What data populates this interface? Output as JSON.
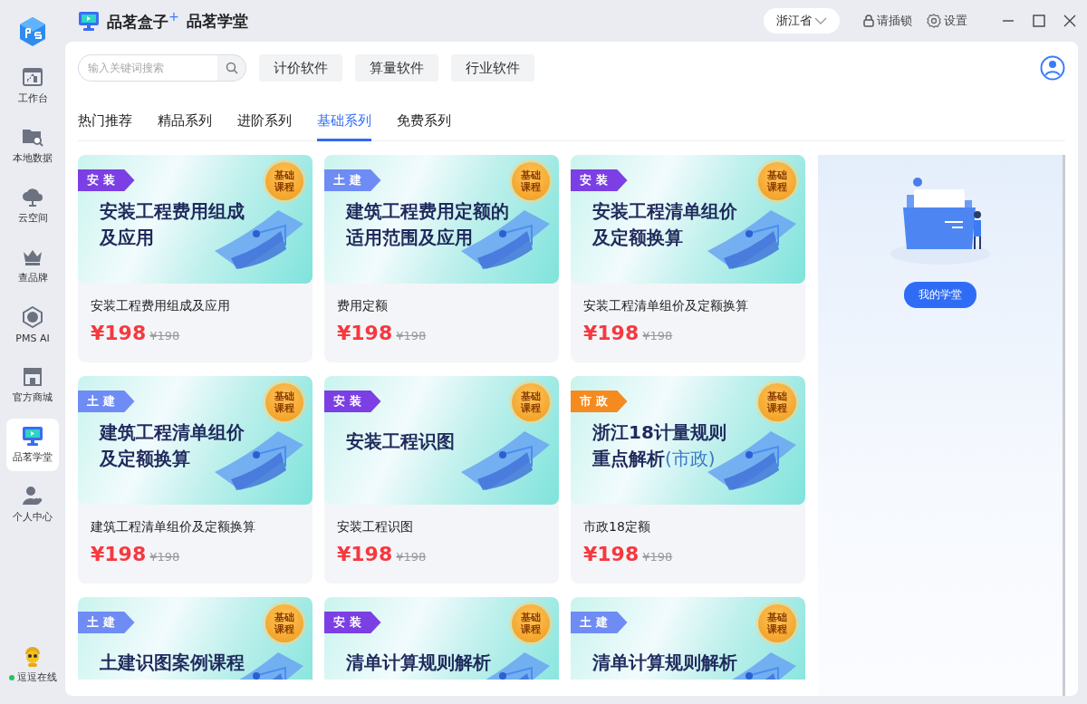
{
  "titlebar": {
    "app_name": "品茗盒子$^{+}$",
    "section": "品茗学堂",
    "region": "浙江省",
    "lock": "请插锁",
    "settings": "设置"
  },
  "sidebar": {
    "items": [
      {
        "label": "工作台",
        "selected": false
      },
      {
        "label": "本地数据",
        "selected": false
      },
      {
        "label": "云空间",
        "selected": false
      },
      {
        "label": "查品牌",
        "selected": false
      },
      {
        "label": "PMS AI",
        "selected": false
      },
      {
        "label": "官方商城",
        "selected": false
      },
      {
        "label": "品茗学堂",
        "selected": true
      },
      {
        "label": "个人中心",
        "selected": false
      }
    ],
    "status": {
      "label": "逗逗在线",
      "online": true
    }
  },
  "toolbar": {
    "search": {
      "placeholder": "输入关键词搜索"
    },
    "buttons": [
      "计价软件",
      "算量软件",
      "行业软件"
    ]
  },
  "tabs": [
    {
      "label": "热门推荐",
      "selected": false
    },
    {
      "label": "精品系列",
      "selected": false
    },
    {
      "label": "进阶系列",
      "selected": false
    },
    {
      "label": "基础系列",
      "selected": true
    },
    {
      "label": "免费系列",
      "selected": false
    }
  ],
  "courses": [
    {
      "tag": "安 装",
      "color": "#7b3fe4",
      "badge": "基础课程",
      "banner_lines": [
        "安装工程费用组成",
        "及应用"
      ],
      "title": "安装工程费用组成及应用",
      "price": "¥198",
      "original_price": "¥198"
    },
    {
      "tag": "土 建",
      "color": "#6f8cf5",
      "badge": "基础课程",
      "banner_lines": [
        "建筑工程费用定额的",
        "适用范围及应用"
      ],
      "title": "费用定额",
      "price": "¥198",
      "original_price": "¥198"
    },
    {
      "tag": "安 装",
      "color": "#7b3fe4",
      "badge": "基础课程",
      "banner_lines": [
        "安装工程清单组价",
        "及定额换算"
      ],
      "title": "安装工程清单组价及定额换算",
      "price": "¥198",
      "original_price": "¥198"
    },
    {
      "tag": "土 建",
      "color": "#6f8cf5",
      "badge": "基础课程",
      "banner_lines": [
        "建筑工程清单组价",
        "及定额换算"
      ],
      "title": "建筑工程清单组价及定额换算",
      "price": "¥198",
      "original_price": "¥198"
    },
    {
      "tag": "安 装",
      "color": "#7b3fe4",
      "badge": "基础课程",
      "banner_lines": [
        "安装工程识图"
      ],
      "title": "安装工程识图",
      "price": "¥198",
      "original_price": "¥198"
    },
    {
      "tag": "市 政",
      "color": "#f58a1f",
      "badge": "基础课程",
      "banner_lines": [
        "浙江18计量规则",
        "重点解析"
      ],
      "banner_note": "(市政)",
      "title": "市政18定额",
      "price": "¥198",
      "original_price": "¥198"
    },
    {
      "tag": "土 建",
      "color": "#6f8cf5",
      "badge": "基础课程",
      "banner_lines": [
        "土建识图案例课程"
      ]
    },
    {
      "tag": "安 装",
      "color": "#7b3fe4",
      "badge": "基础课程",
      "banner_lines": [
        "清单计算规则解析"
      ]
    },
    {
      "tag": "土 建",
      "color": "#6f8cf5",
      "badge": "基础课程",
      "banner_lines": [
        "清单计算规则解析"
      ]
    }
  ],
  "side_panel": {
    "button": "我的学堂"
  }
}
